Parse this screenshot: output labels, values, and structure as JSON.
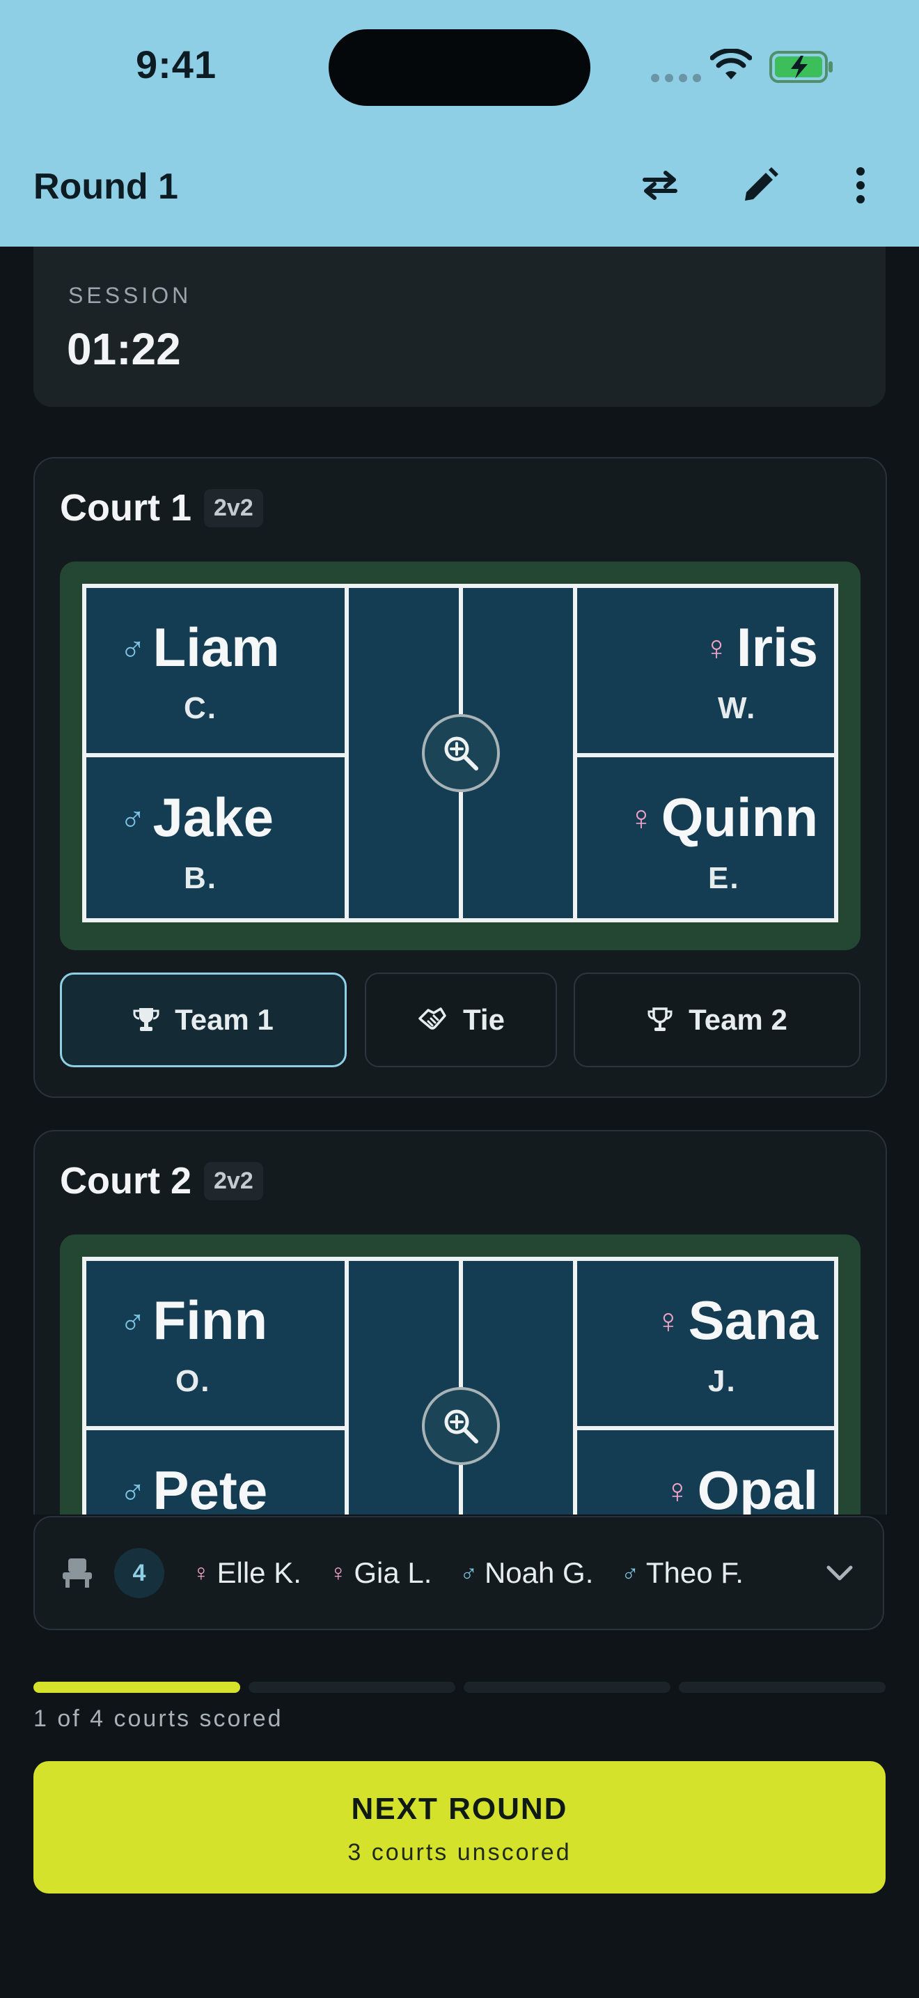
{
  "status_bar": {
    "time": "9:41"
  },
  "app_bar": {
    "title": "Round 1",
    "icons": [
      "swap-icon",
      "edit-icon",
      "more-vertical-icon"
    ]
  },
  "session": {
    "label": "SESSION",
    "value": "01:22"
  },
  "courts": [
    {
      "name": "Court 1",
      "format": "2v2",
      "team1": [
        {
          "name": "Liam",
          "initial": "C.",
          "gender": "male"
        },
        {
          "name": "Jake",
          "initial": "B.",
          "gender": "male"
        }
      ],
      "team2": [
        {
          "name": "Iris",
          "initial": "W.",
          "gender": "female"
        },
        {
          "name": "Quinn",
          "initial": "E.",
          "gender": "female"
        }
      ],
      "results": {
        "team1_label": "Team 1",
        "tie_label": "Tie",
        "team2_label": "Team 2",
        "selected": "team1"
      }
    },
    {
      "name": "Court 2",
      "format": "2v2",
      "team1": [
        {
          "name": "Finn",
          "initial": "O.",
          "gender": "male"
        },
        {
          "name": "Pete",
          "initial": "",
          "gender": "male"
        }
      ],
      "team2": [
        {
          "name": "Sana",
          "initial": "J.",
          "gender": "female"
        },
        {
          "name": "Opal",
          "initial": "",
          "gender": "female"
        }
      ]
    }
  ],
  "bench": {
    "count": "4",
    "players": [
      {
        "name": "Elle K.",
        "gender": "female"
      },
      {
        "name": "Gia L.",
        "gender": "female"
      },
      {
        "name": "Noah G.",
        "gender": "male"
      },
      {
        "name": "Theo F.",
        "gender": "male"
      }
    ]
  },
  "progress": {
    "scored": 1,
    "total": 4,
    "label": "1 of 4 courts scored"
  },
  "next_round": {
    "title": "NEXT ROUND",
    "subtitle": "3 courts unscored"
  },
  "colors": {
    "accent": "#8fcfe6",
    "primary_button": "#d4e22c",
    "male": "#7fc6e6",
    "female": "#f2a3c8"
  }
}
